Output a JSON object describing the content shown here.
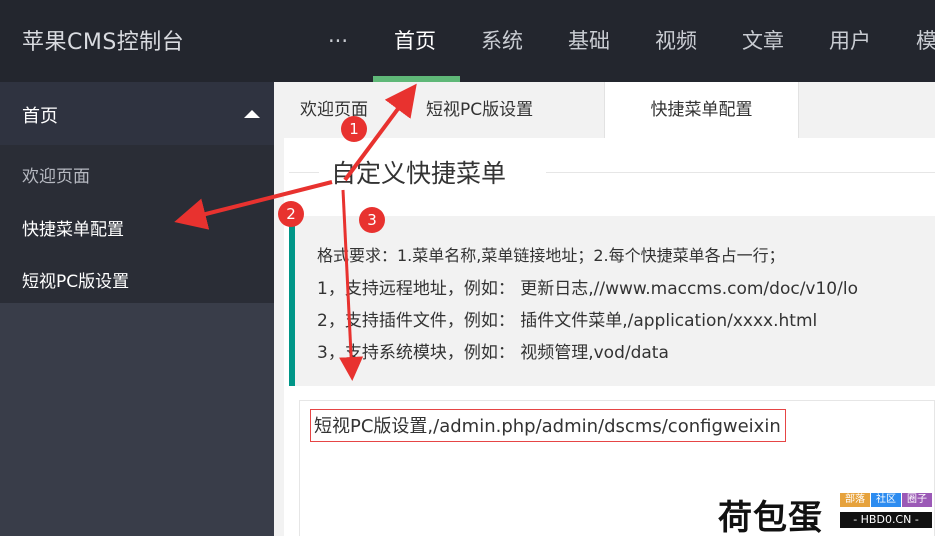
{
  "app": {
    "title": "苹果CMS控制台"
  },
  "topnav": {
    "more": "···",
    "items": [
      "首页",
      "系统",
      "基础",
      "视频",
      "文章",
      "用户",
      "模"
    ],
    "active": "首页",
    "accent": "#5fb878"
  },
  "sidebar": {
    "group": "首页",
    "items": [
      "欢迎页面",
      "快捷菜单配置",
      "短视PC版设置"
    ]
  },
  "tabs": [
    "欢迎页面",
    "短视PC版设置",
    "快捷菜单配置"
  ],
  "section": {
    "legend": "自定义快捷菜单",
    "tips": [
      "格式要求：1.菜单名称,菜单链接地址；2.每个快捷菜单各占一行；",
      "1，支持远程地址，例如： 更新日志,//www.maccms.com/doc/v10/lo",
      "2，支持插件文件，例如： 插件文件菜单,/application/xxxx.html",
      "3，支持系统模块，例如： 视频管理,vod/data"
    ],
    "textarea_value": "短视PC版设置,/admin.php/admin/dscms/configweixin"
  },
  "annotations": {
    "badges": [
      "1",
      "2",
      "3"
    ],
    "color": "#e8322f"
  },
  "watermark": {
    "name": "荷包蛋",
    "tags": [
      "部落",
      "社区",
      "圈子"
    ],
    "url": "- HBD0.CN -"
  }
}
